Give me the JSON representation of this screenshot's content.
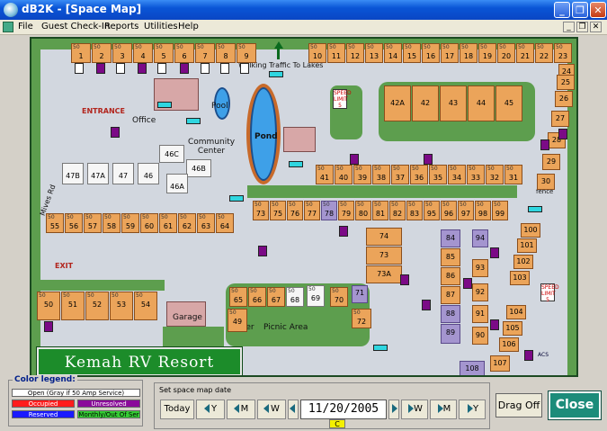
{
  "window": {
    "title": "dB2K - [Space Map]"
  },
  "window_controls": {
    "minimize": "_",
    "restore": "❐",
    "close": "✕"
  },
  "menu": {
    "items": [
      "File",
      "Guest Check-In",
      "Reports",
      "Utilities",
      "Help"
    ],
    "doc_controls": [
      "_",
      "❐",
      "✕"
    ]
  },
  "map": {
    "resort_name": "Kemah RV Resort",
    "labels": {
      "entrance": "ENTRANCE",
      "exit": "EXIT",
      "office": "Office",
      "pool": "Pool",
      "pond": "Pond",
      "community_center": "Community Center",
      "walking_traffic": "Walking Traffic To Lakes",
      "road": "Mives Rd",
      "garage": "Garage",
      "trailer": "Trailer",
      "picnic_area": "Picnic Area",
      "fence": "fence",
      "speed_sign": "SPEED LIMIT 5",
      "speed_sign_2": "SPEED LIMIT 5",
      "north": "N",
      "compass": "ACS"
    },
    "site_size_label": "50",
    "rows": {
      "top": [
        "1",
        "2",
        "3",
        "4",
        "5",
        "6",
        "7",
        "8",
        "9",
        "10",
        "11",
        "12",
        "13",
        "14",
        "15",
        "16",
        "17",
        "18",
        "19",
        "20",
        "21",
        "22",
        "23",
        "24"
      ],
      "right": [
        "25",
        "26",
        "27",
        "28",
        "29",
        "30"
      ],
      "mid_right": [
        "42A",
        "42",
        "43",
        "44",
        "45"
      ],
      "row_31": [
        "41",
        "40",
        "39",
        "38",
        "37",
        "36",
        "35",
        "34",
        "33",
        "32",
        "31"
      ],
      "row_47": [
        "47B",
        "47A",
        "47",
        "46",
        "46A"
      ],
      "center_46": [
        "46C",
        "46B"
      ],
      "row_55": [
        "55",
        "56",
        "57",
        "58",
        "59",
        "60",
        "61",
        "62",
        "63",
        "64"
      ],
      "row_73": [
        "73",
        "75",
        "76",
        "77",
        "78",
        "79",
        "80",
        "81",
        "82",
        "83",
        "95",
        "96",
        "97",
        "98",
        "99"
      ],
      "col_74": [
        "74",
        "73",
        "73A"
      ],
      "col_84": [
        "84",
        "85",
        "86",
        "87",
        "88",
        "89"
      ],
      "col_94": [
        "94",
        "93",
        "92",
        "91",
        "90"
      ],
      "col_100": [
        "100",
        "101",
        "102",
        "103",
        "104",
        "105",
        "106",
        "107"
      ],
      "row_50": [
        "50",
        "51",
        "52",
        "53",
        "54"
      ],
      "row_65": [
        "65",
        "66",
        "67",
        "68",
        "69",
        "70",
        "71"
      ],
      "misc": [
        "49",
        "72",
        "108"
      ]
    }
  },
  "legend": {
    "title": "Color legend:",
    "open": "Open (Gray if 50 Amp Service)",
    "occupied": "Occupied",
    "unresolved": "Unresolved",
    "reserved": "Reserved",
    "monthly": "Monthly/Out Of Ser",
    "colors": {
      "occupied": "#ff1c1c",
      "unresolved": "#8a0a9a",
      "reserved": "#1a1aff",
      "monthly": "#33cc33"
    }
  },
  "date_panel": {
    "title": "Set space map date",
    "today": "Today",
    "year": "Y",
    "month": "M",
    "week": "W",
    "date": "11/20/2005",
    "calendar": "C"
  },
  "buttons": {
    "drag_off": "Drag Off",
    "close": "Close"
  }
}
